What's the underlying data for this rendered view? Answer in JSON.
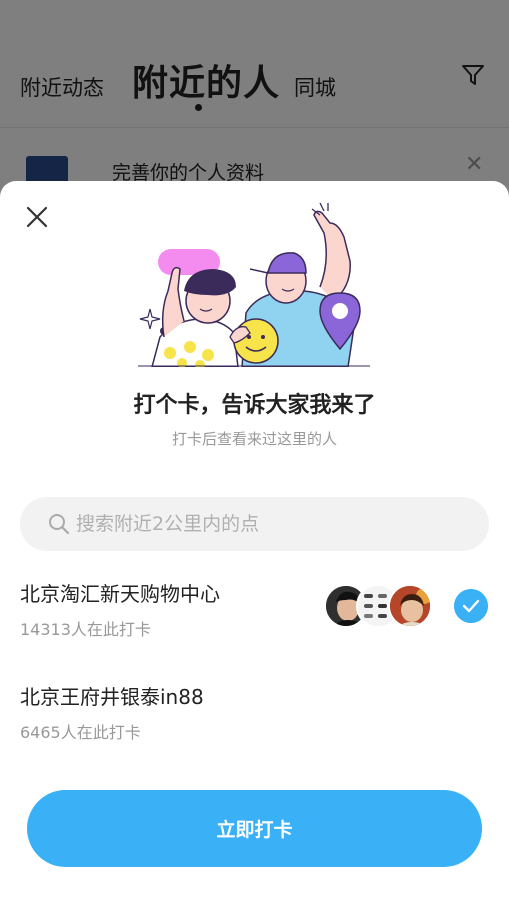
{
  "background": {
    "tabs": [
      {
        "label": "附近动态"
      },
      {
        "label": "附近的人"
      },
      {
        "label": "同城"
      }
    ],
    "card": {
      "text": "完善你的个人资料"
    }
  },
  "sheet": {
    "title": "打个卡，告诉大家我来了",
    "subtitle": "打卡后查看来过这里的人",
    "search": {
      "placeholder": "搜索附近2公里内的点"
    },
    "locations": [
      {
        "name": "北京淘汇新天购物中心",
        "count": "14313人在此打卡",
        "selected": true
      },
      {
        "name": "北京王府井银泰in88",
        "count": "6465人在此打卡",
        "selected": false
      }
    ],
    "button_label": "立即打卡"
  },
  "colors": {
    "accent": "#3ab1f6",
    "pin": "#8a66d8",
    "bubble": "#f48cf0"
  }
}
